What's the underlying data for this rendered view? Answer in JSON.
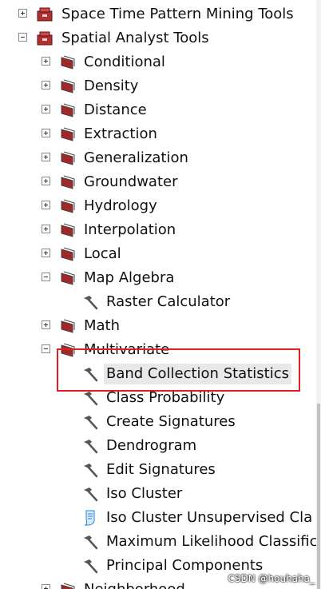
{
  "tree": {
    "items": [
      {
        "label": "Space Time Pattern Mining Tools",
        "icon": "toolbox-icon",
        "expander": "plus"
      },
      {
        "label": "Spatial Analyst Tools",
        "icon": "toolbox-icon",
        "expander": "minus"
      },
      {
        "label": "Conditional",
        "icon": "toolset-icon",
        "expander": "plus"
      },
      {
        "label": "Density",
        "icon": "toolset-icon",
        "expander": "plus"
      },
      {
        "label": "Distance",
        "icon": "toolset-icon",
        "expander": "plus"
      },
      {
        "label": "Extraction",
        "icon": "toolset-icon",
        "expander": "plus"
      },
      {
        "label": "Generalization",
        "icon": "toolset-icon",
        "expander": "plus"
      },
      {
        "label": "Groundwater",
        "icon": "toolset-icon",
        "expander": "plus"
      },
      {
        "label": "Hydrology",
        "icon": "toolset-icon",
        "expander": "plus"
      },
      {
        "label": "Interpolation",
        "icon": "toolset-icon",
        "expander": "plus"
      },
      {
        "label": "Local",
        "icon": "toolset-icon",
        "expander": "plus"
      },
      {
        "label": "Map Algebra",
        "icon": "toolset-icon",
        "expander": "minus"
      },
      {
        "label": "Raster Calculator",
        "icon": "hammer-icon",
        "expander": ""
      },
      {
        "label": "Math",
        "icon": "toolset-icon",
        "expander": "plus"
      },
      {
        "label": "Multivariate",
        "icon": "toolset-icon",
        "expander": "minus"
      },
      {
        "label": "Band Collection Statistics",
        "icon": "hammer-icon",
        "expander": "",
        "selected": true
      },
      {
        "label": "Class Probability",
        "icon": "hammer-icon",
        "expander": ""
      },
      {
        "label": "Create Signatures",
        "icon": "hammer-icon",
        "expander": ""
      },
      {
        "label": "Dendrogram",
        "icon": "hammer-icon",
        "expander": ""
      },
      {
        "label": "Edit Signatures",
        "icon": "hammer-icon",
        "expander": ""
      },
      {
        "label": "Iso Cluster",
        "icon": "hammer-icon",
        "expander": ""
      },
      {
        "label": "Iso Cluster Unsupervised Cla",
        "icon": "script-icon",
        "expander": ""
      },
      {
        "label": "Maximum Likelihood Classific",
        "icon": "hammer-icon",
        "expander": ""
      },
      {
        "label": "Principal Components",
        "icon": "hammer-icon",
        "expander": ""
      },
      {
        "label": "Neighborhood",
        "icon": "toolset-icon",
        "expander": "plus"
      }
    ]
  },
  "watermark": "CSDN @houhaha_",
  "colors": {
    "highlight": "#e02020",
    "toolbox": "#b03030",
    "toolset": "#a02828",
    "hammer": "#555555",
    "script": "#2a7fd4"
  }
}
